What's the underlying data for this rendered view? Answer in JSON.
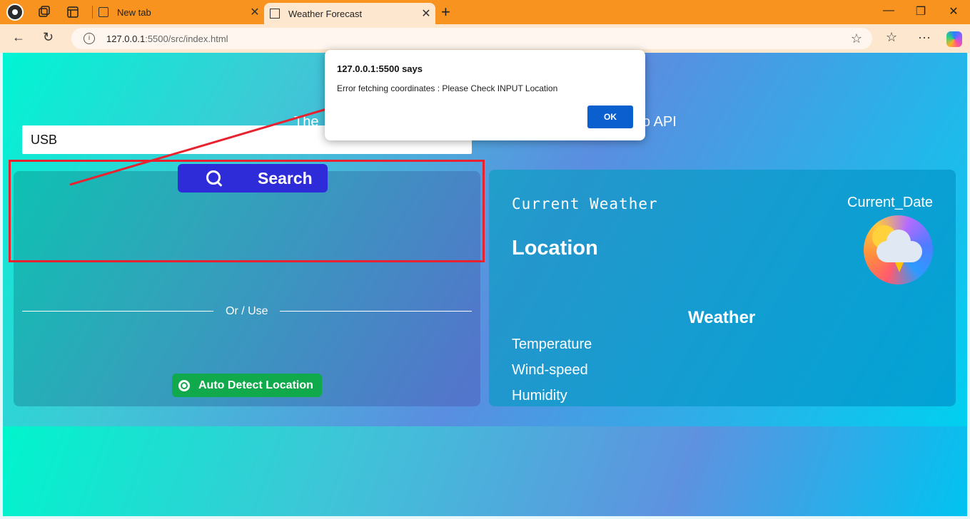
{
  "browser": {
    "tabs": [
      {
        "label": "New tab",
        "active": false
      },
      {
        "label": "Weather Forecast",
        "active": true
      }
    ],
    "url_host": "127.0.0.1",
    "url_rest": ":5500/src/index.html"
  },
  "page": {
    "subtitle_left": "The",
    "subtitle_right": "o API",
    "search": {
      "input_value": "USB",
      "button_label": "Search"
    },
    "or_label": "Or / Use",
    "auto_detect_label": "Auto Detect Location",
    "current_weather": {
      "title": "Current Weather",
      "date": "Current_Date",
      "location": "Location",
      "weather_heading": "Weather",
      "stats": [
        "Temperature",
        "Wind-speed",
        "Humidity"
      ]
    }
  },
  "dialog": {
    "origin": "127.0.0.1:5500 says",
    "message": "Error fetching coordinates : Please Check INPUT Location",
    "ok_label": "OK"
  },
  "colors": {
    "tab_bar": "#f7931e",
    "search_button": "#2e2bd8",
    "auto_detect_button": "#10a94c",
    "annotation": "#e8222e",
    "dialog_ok": "#0b5fce"
  }
}
